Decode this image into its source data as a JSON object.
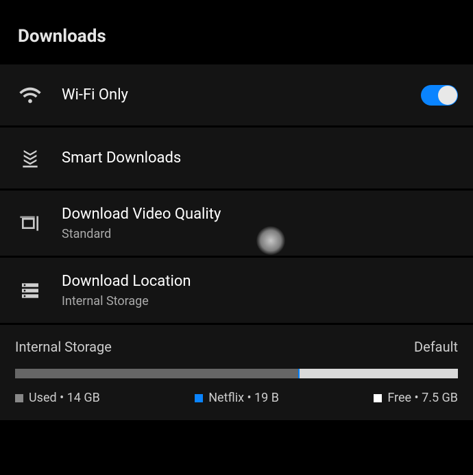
{
  "section": {
    "title": "Downloads"
  },
  "rows": {
    "wifi": {
      "label": "Wi-Fi Only",
      "toggle_on": true
    },
    "smart": {
      "label": "Smart Downloads"
    },
    "quality": {
      "label": "Download Video Quality",
      "value": "Standard"
    },
    "location": {
      "label": "Download Location",
      "value": "Internal Storage"
    }
  },
  "storage": {
    "title": "Internal Storage",
    "badge": "Default",
    "used": {
      "label": "Used",
      "value": "14 GB",
      "pct": 64
    },
    "app": {
      "label": "Netflix",
      "value": "19 B",
      "pct": 0.3
    },
    "free": {
      "label": "Free",
      "value": "7.5 GB",
      "pct": 35.7
    }
  },
  "colors": {
    "accent": "#0a84ff"
  }
}
